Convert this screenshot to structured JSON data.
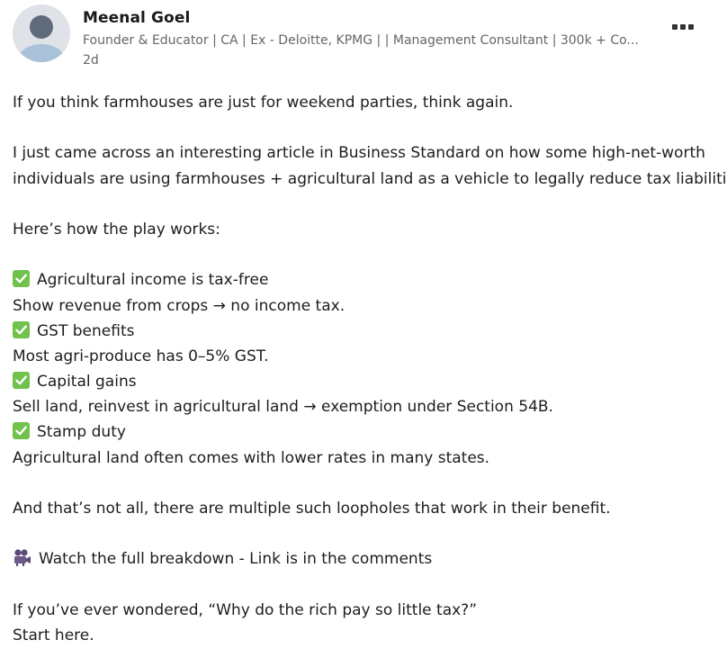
{
  "author": {
    "name": "Meenal Goel",
    "headline": "Founder & Educator | CA | Ex - Deloitte, KPMG | | Management Consultant | 300k + Co...",
    "post_age": "2d"
  },
  "menu": {
    "icon": "more-horizontal-icon"
  },
  "post": {
    "intro": "If you think farmhouses are just for weekend parties, think again.",
    "article_line1": "I just came across an interesting article in Business Standard on how some high-net-worth",
    "article_line2": "individuals are using farmhouses + agricultural land as a vehicle to legally reduce tax liabilities.",
    "play_heading": "Here’s how the play works:",
    "points": [
      {
        "icon": "check-mark-icon",
        "title": "Agricultural income is tax-free",
        "detail": "Show revenue from crops → no income tax."
      },
      {
        "icon": "check-mark-icon",
        "title": "GST benefits",
        "detail": "Most agri-produce has 0–5% GST."
      },
      {
        "icon": "check-mark-icon",
        "title": "Capital gains",
        "detail": "Sell land, reinvest in agricultural land → exemption under Section 54B."
      },
      {
        "icon": "check-mark-icon",
        "title": "Stamp duty",
        "detail": "Agricultural land often comes with lower rates in many states."
      }
    ],
    "not_all": "And that’s not all, there are multiple such loopholes that work in their benefit.",
    "watch": "Watch the full breakdown - Link is in the comments",
    "watch_icon": "video-camera-icon",
    "closing_line1": "If you’ve ever wondered, “Why do the rich pay so little tax?”",
    "closing_line2": "Start here."
  },
  "colors": {
    "check_green": "#71c14d",
    "meta_gray": "#666666",
    "text": "#1d1d1d"
  }
}
